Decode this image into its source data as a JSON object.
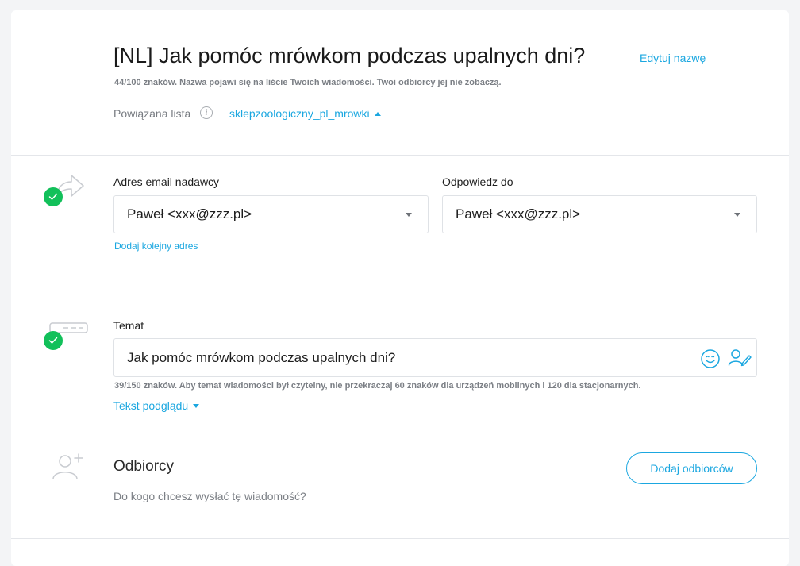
{
  "header": {
    "title": "[NL] Jak pomóc mrówkom podczas upalnych dni?",
    "edit_name": "Edytuj nazwę",
    "name_hint": "44/100 znaków. Nazwa pojawi się na liście Twoich wiadomości. Twoi odbiorcy jej nie zobaczą.",
    "linked_list_label": "Powiązana lista",
    "linked_list_value": "sklepzoologiczny_pl_mrowki"
  },
  "sender": {
    "from_label": "Adres email nadawcy",
    "from_value": "Paweł <xxx@zzz.pl>",
    "reply_label": "Odpowiedz do",
    "reply_value": "Paweł <xxx@zzz.pl>",
    "add_address": "Dodaj kolejny adres"
  },
  "subject": {
    "label": "Temat",
    "value": "Jak pomóc mrówkom podczas upalnych dni?",
    "hint": "39/150 znaków. Aby temat wiadomości był czytelny, nie przekraczaj 60 znaków dla urządzeń mobilnych i 120 dla stacjonarnych.",
    "preview_text": "Tekst podglądu"
  },
  "recipients": {
    "title": "Odbiorcy",
    "subtitle": "Do kogo chcesz wysłać tę wiadomość?",
    "add_button": "Dodaj odbiorców"
  },
  "icons": {
    "info": "i"
  },
  "colors": {
    "accent": "#1ba7e0",
    "success": "#12c05a"
  }
}
